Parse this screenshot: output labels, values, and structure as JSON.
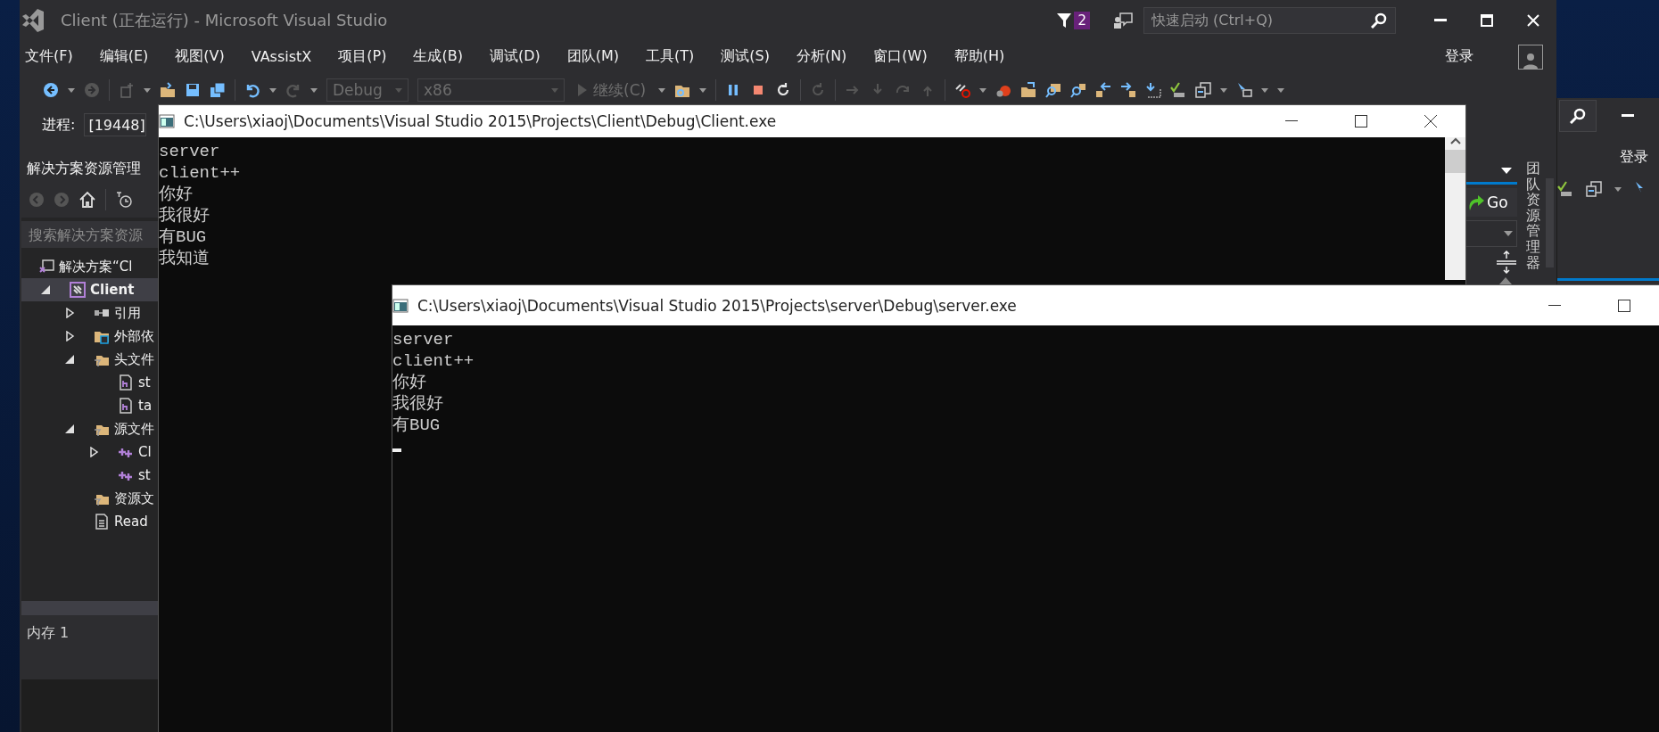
{
  "vs_window": {
    "title": "Client (正在运行) - Microsoft Visual Studio",
    "notification_count": "2",
    "quick_launch": {
      "placeholder": "快速启动 (Ctrl+Q)"
    },
    "menu": [
      "文件(F)",
      "编辑(E)",
      "视图(V)",
      "VAssistX",
      "项目(P)",
      "生成(B)",
      "调试(D)",
      "团队(M)",
      "工具(T)",
      "测试(S)",
      "分析(N)",
      "窗口(W)",
      "帮助(H)"
    ],
    "sign_in": "登录",
    "toolbar": {
      "configuration": "Debug",
      "platform": "x86",
      "continue_label": "继续(C)"
    },
    "process": {
      "label": "进程:",
      "value": "[19448]"
    },
    "solution_explorer": {
      "title": "解决方案资源管理",
      "search": {
        "placeholder": "搜索解决方案资源"
      },
      "tree": [
        {
          "label": "解决方案“Cl",
          "kind": "solution",
          "selected": false,
          "children": [
            {
              "label": "Client",
              "kind": "project",
              "selected": true,
              "expanded": true,
              "children": [
                {
                  "label": "引用",
                  "kind": "references",
                  "selected": false,
                  "expanded": false
                },
                {
                  "label": "外部依",
                  "kind": "external",
                  "selected": false,
                  "expanded": false
                },
                {
                  "label": "头文件",
                  "kind": "filter",
                  "selected": false,
                  "expanded": true,
                  "children": [
                    {
                      "label": "st",
                      "kind": "header",
                      "selected": false
                    },
                    {
                      "label": "ta",
                      "kind": "header",
                      "selected": false
                    }
                  ]
                },
                {
                  "label": "源文件",
                  "kind": "filter",
                  "selected": false,
                  "expanded": true,
                  "children": [
                    {
                      "label": "Cl",
                      "kind": "source",
                      "selected": false,
                      "expanded": false
                    },
                    {
                      "label": "st",
                      "kind": "source",
                      "selected": false
                    }
                  ]
                },
                {
                  "label": "资源文",
                  "kind": "filter",
                  "selected": false
                },
                {
                  "label": "Read",
                  "kind": "text",
                  "selected": false
                }
              ]
            }
          ]
        }
      ]
    },
    "memory_panel": {
      "title": "内存 1"
    },
    "side_panel": {
      "tab": "团队资源管理器",
      "go_button": "Go"
    }
  },
  "background_vs_window": {
    "sign_in": "登录"
  },
  "console_windows": [
    {
      "title": "C:\\Users\\xiaoj\\Documents\\Visual Studio 2015\\Projects\\Client\\Debug\\Client.exe",
      "lines": [
        "server",
        "client++",
        "你好",
        "我很好",
        "有BUG",
        "我知道"
      ],
      "cursor": false,
      "scrollbar": true
    },
    {
      "title": "C:\\Users\\xiaoj\\Documents\\Visual Studio 2015\\Projects\\server\\Debug\\server.exe",
      "lines": [
        "server",
        "client++",
        "你好",
        "我很好",
        "有BUG"
      ],
      "cursor": true,
      "scrollbar": false
    }
  ]
}
